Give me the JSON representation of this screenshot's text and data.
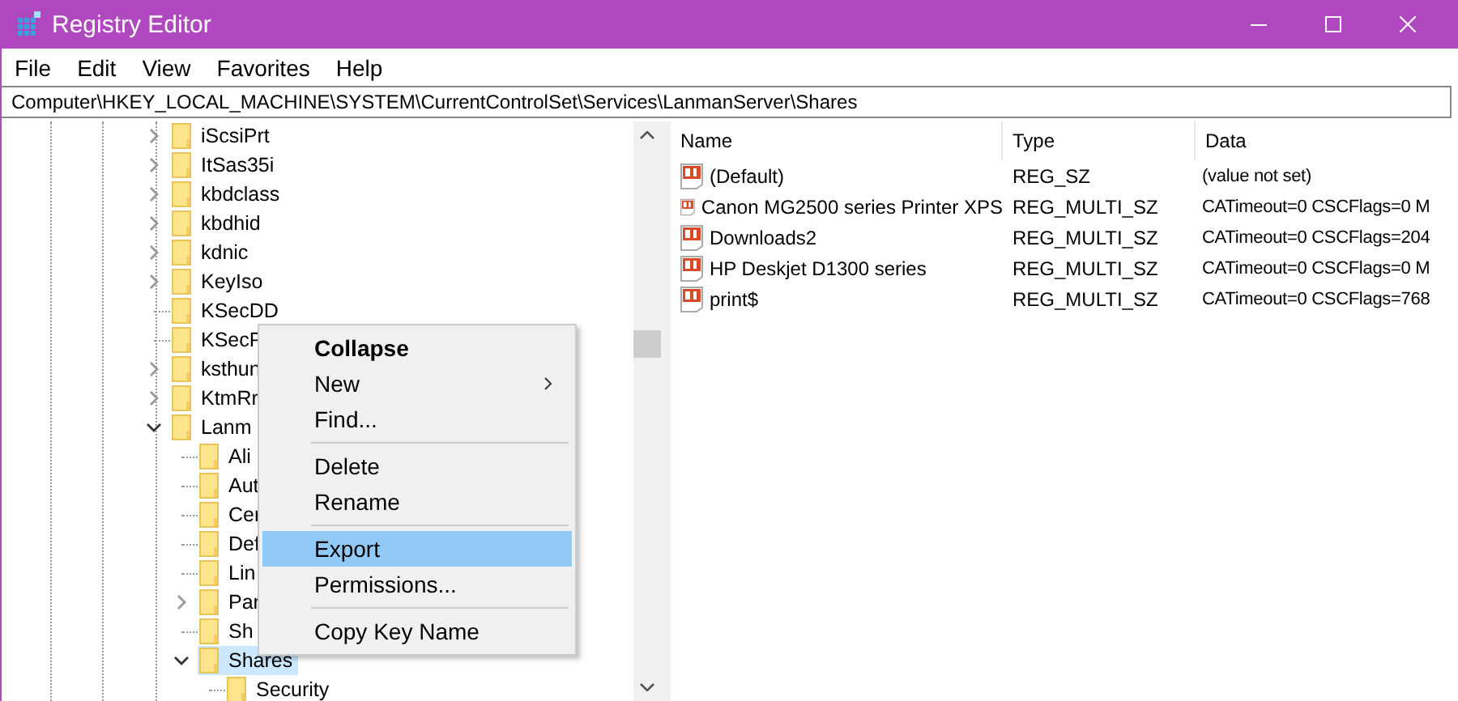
{
  "window": {
    "title": "Registry Editor"
  },
  "menu_bar": [
    "File",
    "Edit",
    "View",
    "Favorites",
    "Help"
  ],
  "address": "Computer\\HKEY_LOCAL_MACHINE\\SYSTEM\\CurrentControlSet\\Services\\LanmanServer\\Shares",
  "tree": [
    {
      "kind": "branch",
      "label": "iScsiPrt",
      "expanded": false,
      "selected": false
    },
    {
      "kind": "branch",
      "label": "ItSas35i",
      "expanded": false,
      "selected": false
    },
    {
      "kind": "branch",
      "label": "kbdclass",
      "expanded": false,
      "selected": false
    },
    {
      "kind": "branch",
      "label": "kbdhid",
      "expanded": false,
      "selected": false
    },
    {
      "kind": "branch",
      "label": "kdnic",
      "expanded": false,
      "selected": false
    },
    {
      "kind": "branch",
      "label": "KeyIso",
      "expanded": false,
      "selected": false
    },
    {
      "kind": "leaf",
      "label": "KSecDD",
      "selected": false
    },
    {
      "kind": "leaf",
      "label": "KSecP",
      "selected": false
    },
    {
      "kind": "branch",
      "label": "ksthun",
      "expanded": false,
      "selected": false
    },
    {
      "kind": "branch",
      "label": "KtmRr",
      "expanded": false,
      "selected": false
    },
    {
      "kind": "branch",
      "label": "Lanm",
      "expanded": true,
      "selected": false,
      "children": [
        {
          "kind": "leaf",
          "label": "Ali",
          "selected": false
        },
        {
          "kind": "leaf",
          "label": "Aut",
          "selected": false
        },
        {
          "kind": "leaf",
          "label": "Cer",
          "selected": false
        },
        {
          "kind": "leaf",
          "label": "Def",
          "selected": false
        },
        {
          "kind": "leaf",
          "label": "Lin",
          "selected": false
        },
        {
          "kind": "branch",
          "label": "Par",
          "expanded": false,
          "selected": false
        },
        {
          "kind": "leaf",
          "label": "Sh",
          "selected": false
        },
        {
          "kind": "branch",
          "label": "Shares",
          "expanded": true,
          "selected": true,
          "children": [
            {
              "kind": "leaf",
              "label": "Security",
              "selected": false
            }
          ]
        }
      ]
    }
  ],
  "context_menu": [
    {
      "kind": "item",
      "label": "Collapse",
      "bold": true,
      "submenu": false,
      "selected": false
    },
    {
      "kind": "item",
      "label": "New",
      "bold": false,
      "submenu": true,
      "selected": false
    },
    {
      "kind": "item",
      "label": "Find...",
      "bold": false,
      "submenu": false,
      "selected": false
    },
    {
      "kind": "separator"
    },
    {
      "kind": "item",
      "label": "Delete",
      "bold": false,
      "submenu": false,
      "selected": false
    },
    {
      "kind": "item",
      "label": "Rename",
      "bold": false,
      "submenu": false,
      "selected": false
    },
    {
      "kind": "separator"
    },
    {
      "kind": "item",
      "label": "Export",
      "bold": false,
      "submenu": false,
      "selected": true
    },
    {
      "kind": "item",
      "label": "Permissions...",
      "bold": false,
      "submenu": false,
      "selected": false
    },
    {
      "kind": "separator"
    },
    {
      "kind": "item",
      "label": "Copy Key Name",
      "bold": false,
      "submenu": false,
      "selected": false
    }
  ],
  "table": {
    "columns": [
      "Name",
      "Type",
      "Data"
    ],
    "rows": [
      {
        "name": "(Default)",
        "type": "REG_SZ",
        "data": "(value not set)"
      },
      {
        "name": "Canon MG2500 series Printer XPS",
        "type": "REG_MULTI_SZ",
        "data": "CATimeout=0 CSCFlags=0 M"
      },
      {
        "name": "Downloads2",
        "type": "REG_MULTI_SZ",
        "data": "CATimeout=0 CSCFlags=204"
      },
      {
        "name": "HP Deskjet D1300 series",
        "type": "REG_MULTI_SZ",
        "data": "CATimeout=0 CSCFlags=0 M"
      },
      {
        "name": "print$",
        "type": "REG_MULTI_SZ",
        "data": "CATimeout=0 CSCFlags=768"
      }
    ]
  }
}
